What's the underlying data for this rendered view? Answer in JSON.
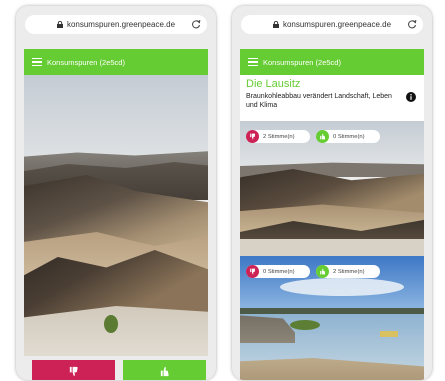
{
  "browser": {
    "url": "konsumspuren.greenpeace.de"
  },
  "app": {
    "title": "Konsumspuren (2e5cd)"
  },
  "detail": {
    "place_title": "Die Lausitz",
    "place_subtitle": "Braunkohleabbau verändert Landschaft, Leben und Klima",
    "card1": {
      "down_label": "2 Stimme(n)",
      "up_label": "0 Stimme(n)"
    },
    "card2": {
      "down_label": "0 Stimme(n)",
      "up_label": "2 Stimme(n)"
    }
  },
  "colors": {
    "brand_green": "#66cc33",
    "vote_red": "#cc2255"
  },
  "icons": {
    "lock": "lock-icon",
    "reload": "reload-icon",
    "menu": "hamburger-menu-icon",
    "thumbs_down": "thumbs-down-icon",
    "thumbs_up": "thumbs-up-icon",
    "info": "info-icon"
  }
}
